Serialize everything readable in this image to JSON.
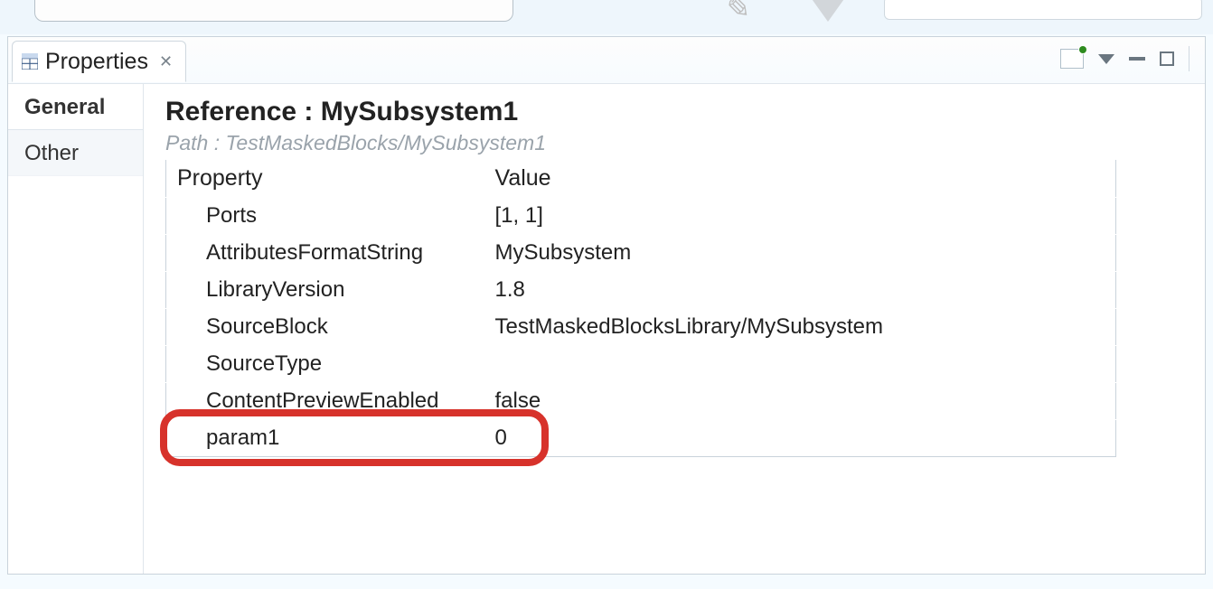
{
  "tab": {
    "title": "Properties"
  },
  "sidebar": {
    "items": [
      {
        "label": "General"
      },
      {
        "label": "Other"
      }
    ]
  },
  "header": {
    "title": "Reference : MySubsystem1",
    "path_label": "Path : TestMaskedBlocks/MySubsystem1"
  },
  "table": {
    "col_property": "Property",
    "col_value": "Value",
    "rows": [
      {
        "property": "Ports",
        "value": "[1, 1]"
      },
      {
        "property": "AttributesFormatString",
        "value": "MySubsystem"
      },
      {
        "property": "LibraryVersion",
        "value": "1.8"
      },
      {
        "property": "SourceBlock",
        "value": "TestMaskedBlocksLibrary/MySubsystem"
      },
      {
        "property": "SourceType",
        "value": ""
      },
      {
        "property": "ContentPreviewEnabled",
        "value": "false"
      },
      {
        "property": "param1",
        "value": "0"
      }
    ]
  }
}
